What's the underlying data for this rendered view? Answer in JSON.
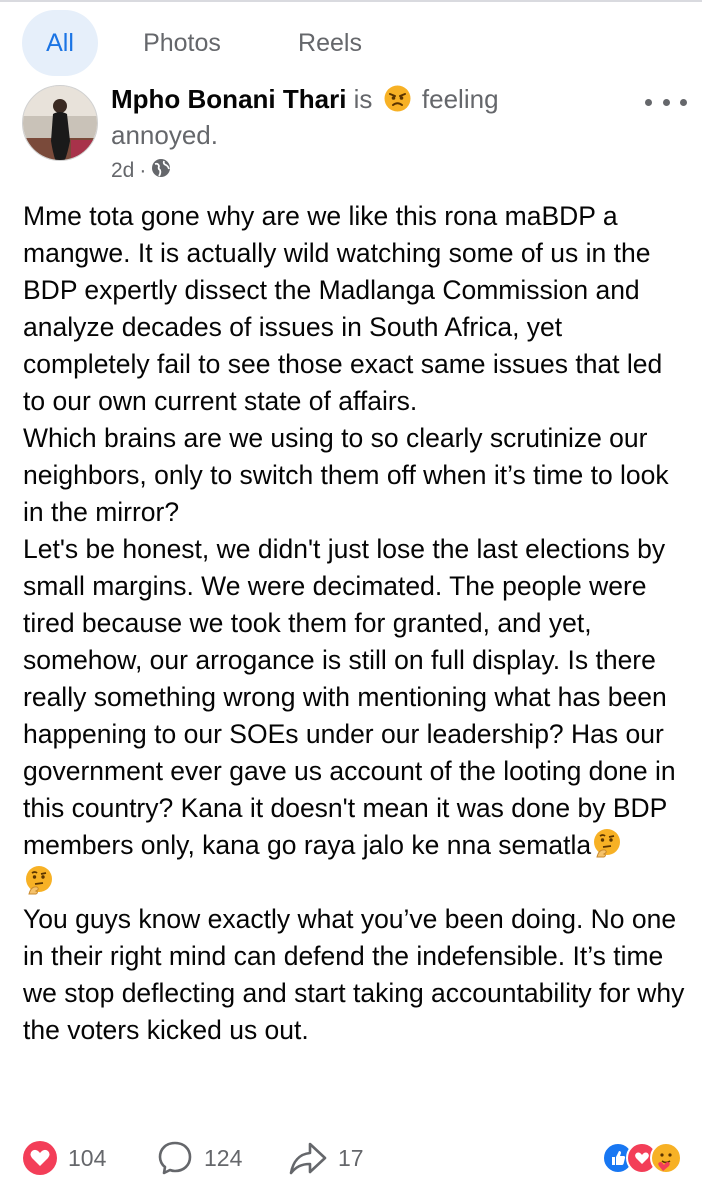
{
  "tabs": [
    {
      "label": "All",
      "active": true
    },
    {
      "label": "Photos",
      "active": false
    },
    {
      "label": "Reels",
      "active": false
    }
  ],
  "post": {
    "author": "Mpho Bonani Thari",
    "activity_prefix": "is",
    "activity_feeling": "feeling",
    "activity_emotion": "annoyed.",
    "feeling_icon": "angry-face-emoji",
    "time": "2d",
    "audience_icon": "globe-icon",
    "paragraphs": [
      "Mme tota gone why are we like this rona maBDP a mangwe. It is actually wild watching some of us in the BDP expertly dissect the Madlanga Commission and analyze decades of issues in South Africa, yet completely fail to see those exact same issues that led to our own current state of affairs.",
      "Which brains are we using to so clearly scrutinize our neighbors, only to switch them off when it’s time to look in the mirror?",
      "Let's be honest,  we didn't just lose the last elections by small margins. We were decimated. The people were tired because we took them for granted, and yet, somehow, our arrogance is still on full display. Is there really something wrong with mentioning what has been happening to our SOEs under our leadership? Has our government ever gave us account of the looting done in this country? Kana it doesn't mean it was done by BDP members only, kana go raya jalo ke nna sematla",
      "You guys know exactly what you’ve been doing. No one in their right mind can defend the indefensible. It’s time we stop deflecting and start taking accountability for why the voters kicked us out."
    ],
    "inline_emoji": "thinking-face-emoji"
  },
  "footer": {
    "likes": "104",
    "comments": "124",
    "shares": "17",
    "reaction_icons": [
      "like-reaction-icon",
      "love-reaction-icon",
      "care-reaction-icon"
    ]
  },
  "colors": {
    "accent": "#1b74e4",
    "tab_active_bg": "#e6effa",
    "heart": "#f33e58",
    "like": "#1877f2",
    "secondary_text": "#65676b"
  }
}
